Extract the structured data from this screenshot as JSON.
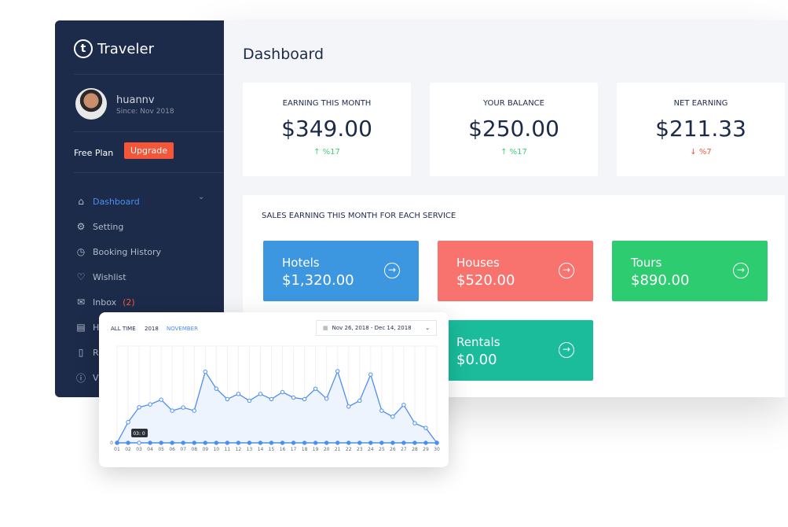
{
  "sidebar": {
    "brand": "Traveler",
    "user": {
      "name": "huannv",
      "since": "Since: Nov 2018"
    },
    "plan": "Free Plan",
    "upgrade": "Upgrade",
    "items": [
      {
        "label": "Dashboard",
        "icon": "home-icon",
        "glyph": "⌂",
        "active": true
      },
      {
        "label": "Setting",
        "icon": "gear-icon",
        "glyph": "⚙"
      },
      {
        "label": "Booking History",
        "icon": "clock-icon",
        "glyph": "◷"
      },
      {
        "label": "Wishlist",
        "icon": "tag-icon",
        "glyph": "♡"
      },
      {
        "label": "Inbox",
        "badge": "(2)",
        "icon": "mail-icon",
        "glyph": "✉"
      },
      {
        "label": "H",
        "icon": "hotel-icon",
        "glyph": "▤"
      },
      {
        "label": "R",
        "icon": "document-icon",
        "glyph": "▯"
      },
      {
        "label": "V",
        "icon": "info-icon",
        "glyph": "ⓘ"
      }
    ]
  },
  "header": {
    "title": "Dashboard"
  },
  "stats": [
    {
      "label": "EARNING THIS MONTH",
      "value": "$349.00",
      "change": "↑ %17",
      "dir": "up"
    },
    {
      "label": "YOUR BALANCE",
      "value": "$250.00",
      "change": "↑ %17",
      "dir": "up"
    },
    {
      "label": "NET EARNING",
      "value": "$211.33",
      "change": "↓ %7",
      "dir": "down"
    }
  ],
  "colors": {
    "up": "#3ecf7a",
    "down": "#f5563a",
    "accent": "#4d8ef0",
    "sidebar": "#1c2b4a"
  },
  "sales": {
    "title": "SALES EARNING THIS MONTH FOR EACH SERVICE",
    "services": [
      {
        "name": "Hotels",
        "amount": "$1,320.00",
        "color": "#3d96e0"
      },
      {
        "name": "Houses",
        "amount": "$520.00",
        "color": "#f8736e"
      },
      {
        "name": "Tours",
        "amount": "$890.00",
        "color": "#2ecc71"
      },
      {
        "name": "Rentals",
        "amount": "$0.00",
        "color": "#1abc9c"
      }
    ]
  },
  "chart_widget": {
    "tabs": [
      "ALL TIME",
      "2018",
      "NOVEMBER"
    ],
    "active_tab": 2,
    "range": "Nov 26, 2018 - Dec 14, 2018",
    "tooltip": "03: 0"
  },
  "chart_data": {
    "type": "line",
    "x": [
      "01",
      "02",
      "03",
      "04",
      "05",
      "06",
      "07",
      "08",
      "09",
      "10",
      "11",
      "12",
      "13",
      "14",
      "15",
      "16",
      "17",
      "18",
      "19",
      "20",
      "21",
      "22",
      "23",
      "24",
      "25",
      "26",
      "27",
      "28",
      "29",
      "30"
    ],
    "series": [
      {
        "values": [
          0,
          79,
          136,
          147,
          165,
          123,
          135,
          123,
          272,
          207,
          167,
          187,
          161,
          187,
          167,
          194,
          173,
          167,
          207,
          169,
          274,
          139,
          161,
          261,
          123,
          100,
          145,
          75,
          57,
          0
        ]
      },
      {
        "values": [
          0,
          0,
          0,
          0,
          0,
          0,
          0,
          0,
          0,
          0,
          0,
          0,
          0,
          0,
          0,
          0,
          0,
          0,
          0,
          0,
          0,
          0,
          0,
          0,
          0,
          0,
          0,
          0,
          0,
          0
        ]
      }
    ],
    "yticks": [
      "0"
    ],
    "grid": "vertical",
    "color": "#4d8ef0"
  }
}
